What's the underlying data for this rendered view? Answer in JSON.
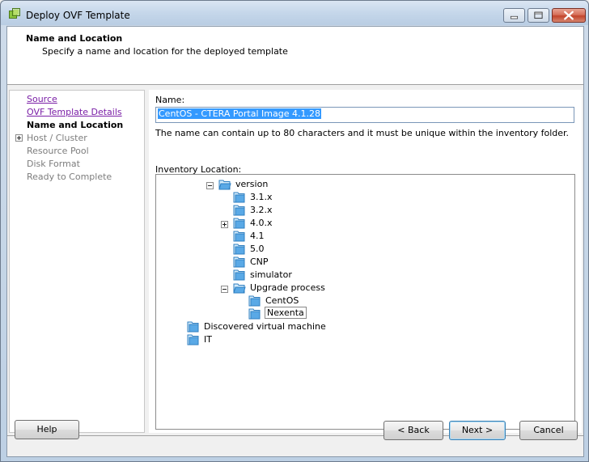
{
  "window": {
    "title": "Deploy OVF Template"
  },
  "header": {
    "title": "Name and Location",
    "subtitle": "Specify a name and location for the deployed template"
  },
  "steps": [
    {
      "label": "Source",
      "state": "link"
    },
    {
      "label": "OVF Template Details",
      "state": "link"
    },
    {
      "label": "Name and Location",
      "state": "current"
    },
    {
      "label": "Host / Cluster",
      "state": "disabled"
    },
    {
      "label": "Resource Pool",
      "state": "disabled"
    },
    {
      "label": "Disk Format",
      "state": "disabled"
    },
    {
      "label": "Ready to Complete",
      "state": "disabled"
    }
  ],
  "form": {
    "name_label": "Name:",
    "name_value": "CentOS - CTERA Portal Image 4.1.28",
    "name_hint": "The name can contain up to 80 characters and it must be unique within the inventory folder.",
    "inventory_label": "Inventory Location:"
  },
  "tree": [
    {
      "label": "version",
      "expander": "minus",
      "folder": "open"
    },
    {
      "label": "3.1.x",
      "expander": "none",
      "folder": "closed"
    },
    {
      "label": "3.2.x",
      "expander": "none",
      "folder": "closed"
    },
    {
      "label": "4.0.x",
      "expander": "plus",
      "folder": "closed"
    },
    {
      "label": "4.1",
      "expander": "none",
      "folder": "closed"
    },
    {
      "label": "5.0",
      "expander": "none",
      "folder": "closed"
    },
    {
      "label": "CNP",
      "expander": "none",
      "folder": "closed"
    },
    {
      "label": "simulator",
      "expander": "none",
      "folder": "closed"
    },
    {
      "label": "Upgrade process",
      "expander": "minus",
      "folder": "open"
    },
    {
      "label": "CentOS",
      "expander": "none",
      "folder": "closed"
    },
    {
      "label": "Nexenta",
      "expander": "none",
      "folder": "closed",
      "selected": true
    },
    {
      "label": "Discovered virtual machine",
      "expander": "none",
      "folder": "closed"
    },
    {
      "label": "IT",
      "expander": "none",
      "folder": "closed"
    }
  ],
  "buttons": {
    "help": "Help",
    "back": "< Back",
    "next": "Next >",
    "cancel": "Cancel"
  },
  "colors": {
    "link": "#7a1fa6",
    "selection": "#3399ff",
    "folder": "#3b8fd6"
  }
}
